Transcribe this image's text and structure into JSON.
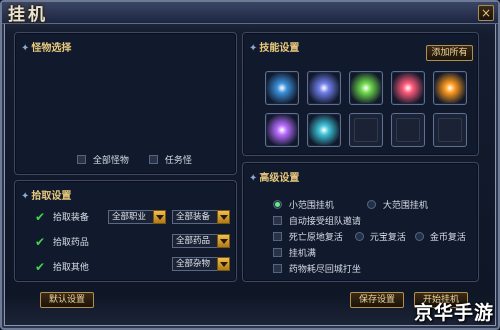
{
  "window": {
    "title": "挂机",
    "close_glyph": "×"
  },
  "monster_panel": {
    "title": "怪物选择",
    "options": [
      {
        "label": "全部怪物",
        "checked": false
      },
      {
        "label": "任务怪",
        "checked": false
      }
    ]
  },
  "pickup_panel": {
    "title": "拾取设置",
    "rows": [
      {
        "label": "拾取装备",
        "checked": true,
        "dropdowns": [
          "全部职业",
          "全部装备"
        ]
      },
      {
        "label": "拾取药品",
        "checked": true,
        "dropdowns": [
          "全部药品"
        ]
      },
      {
        "label": "拾取其他",
        "checked": true,
        "dropdowns": [
          "全部杂物"
        ]
      }
    ]
  },
  "skill_panel": {
    "title": "技能设置",
    "add_all_label": "添加所有",
    "slots": [
      {
        "icon": "blue-ring-skill-icon",
        "filled": true,
        "color": "#3b8fd9"
      },
      {
        "icon": "blade-slash-skill-icon",
        "filled": true,
        "color": "#6f7ee8"
      },
      {
        "icon": "green-burst-skill-icon",
        "filled": true,
        "color": "#6fd94c"
      },
      {
        "icon": "pink-slash-skill-icon",
        "filled": true,
        "color": "#ff5a7a"
      },
      {
        "icon": "fire-claw-skill-icon",
        "filled": true,
        "color": "#ff9a1e"
      },
      {
        "icon": "purple-figure-skill-icon",
        "filled": true,
        "color": "#b86cff"
      },
      {
        "icon": "teal-wings-skill-icon",
        "filled": true,
        "color": "#3ec2d6"
      },
      {
        "icon": "empty-slot",
        "filled": false
      },
      {
        "icon": "empty-slot",
        "filled": false
      },
      {
        "icon": "empty-slot",
        "filled": false
      }
    ]
  },
  "advanced_panel": {
    "title": "高级设置",
    "radio_small": "小范围挂机",
    "radio_large": "大范围挂机",
    "auto_team": "自动接受组队邀请",
    "revive_death": "死亡原地复活",
    "revive_ingot": "元宝复活",
    "revive_gold": "金币复活",
    "hp_line": "挂机满",
    "potion_return": "药物耗尽回城打坐"
  },
  "footer": {
    "default_btn": "默认设置",
    "save_btn": "保存设置",
    "start_btn": "开始挂机"
  },
  "watermark": "京华手游"
}
